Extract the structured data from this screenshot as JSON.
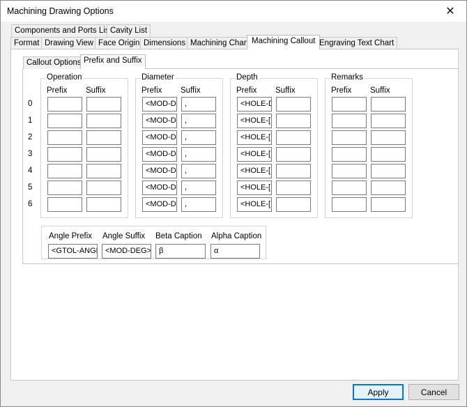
{
  "window": {
    "title": "Machining Drawing Options",
    "close_glyph": "✕"
  },
  "tabs_row1": [
    "Components and Ports List",
    "Cavity List"
  ],
  "tabs_row2": [
    "Format",
    "Drawing View",
    "Face Origin",
    "Dimensions",
    "Machining Chart",
    "Machining Callout",
    "Engraving Text Chart"
  ],
  "active_tab": "Machining Callout",
  "subtabs": [
    "Callout Options",
    "Prefix and Suffix"
  ],
  "active_subtab": "Prefix and Suffix",
  "groups": [
    {
      "label": "Operation",
      "prefix_header": "Prefix",
      "suffix_header": "Suffix",
      "prefix": [
        "",
        "",
        "",
        "",
        "",
        "",
        ""
      ],
      "suffix": [
        "",
        "",
        "",
        "",
        "",
        "",
        ""
      ]
    },
    {
      "label": "Diameter",
      "prefix_header": "Prefix",
      "suffix_header": "Suffix",
      "prefix": [
        "<MOD-DI",
        "<MOD-D",
        "<MOD-D",
        "<MOD-D",
        "<MOD-D",
        "<MOD-D",
        "<MOD-D"
      ],
      "suffix": [
        ",",
        ",",
        ",",
        ",",
        ",",
        ",",
        ","
      ]
    },
    {
      "label": "Depth",
      "prefix_header": "Prefix",
      "suffix_header": "Suffix",
      "prefix": [
        "<HOLE-D",
        "<HOLE-[",
        "<HOLE-[",
        "<HOLE-[",
        "<HOLE-[",
        "<HOLE-[",
        "<HOLE-["
      ],
      "suffix": [
        "",
        "",
        "",
        "",
        "",
        "",
        ""
      ]
    },
    {
      "label": "Remarks",
      "prefix_header": "Prefix",
      "suffix_header": "Suffix",
      "prefix": [
        "",
        "",
        "",
        "",
        "",
        "",
        ""
      ],
      "suffix": [
        "",
        "",
        "",
        "",
        "",
        "",
        ""
      ]
    }
  ],
  "row_labels": [
    "0",
    "1",
    "2",
    "3",
    "4",
    "5",
    "6"
  ],
  "angle": {
    "angle_prefix_label": "Angle Prefix",
    "angle_prefix_value": "<GTOL-ANGL",
    "angle_suffix_label": "Angle Suffix",
    "angle_suffix_value": "<MOD-DEG>",
    "beta_label": "Beta Caption",
    "beta_value": "β",
    "alpha_label": "Alpha Caption",
    "alpha_value": "α"
  },
  "buttons": {
    "apply": "Apply",
    "cancel": "Cancel"
  }
}
